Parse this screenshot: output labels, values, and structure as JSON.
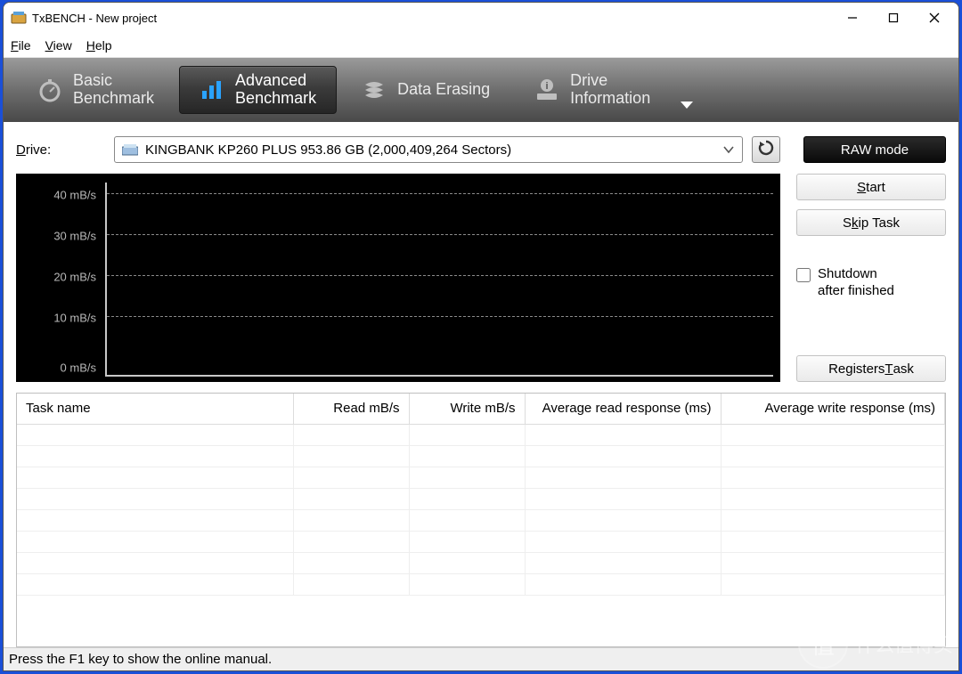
{
  "window": {
    "title": "TxBENCH - New project"
  },
  "menu": {
    "file": "File",
    "view": "View",
    "help": "Help"
  },
  "tabs": {
    "basic": "Basic\nBenchmark",
    "advanced": "Advanced\nBenchmark",
    "erase": "Data Erasing",
    "drive": "Drive\nInformation"
  },
  "drive": {
    "label": "Drive:",
    "selected": "KINGBANK KP260 PLUS  953.86 GB (2,000,409,264 Sectors)",
    "raw_mode": "RAW mode"
  },
  "side": {
    "start": "Start",
    "skip": "Skip Task",
    "shutdown": "Shutdown\nafter finished",
    "registers": "Registers Task"
  },
  "table": {
    "headers": [
      "Task name",
      "Read mB/s",
      "Write mB/s",
      "Average read response (ms)",
      "Average write response (ms)"
    ]
  },
  "chart_data": {
    "type": "line",
    "series": [],
    "y_ticks": [
      "40 mB/s",
      "30 mB/s",
      "20 mB/s",
      "10 mB/s",
      "0 mB/s"
    ],
    "ylim": [
      0,
      45
    ],
    "ylabel": "mB/s",
    "xlabel": ""
  },
  "status": "Press the F1 key to show the online manual.",
  "watermark": {
    "badge": "值",
    "text": "什么值得买"
  }
}
